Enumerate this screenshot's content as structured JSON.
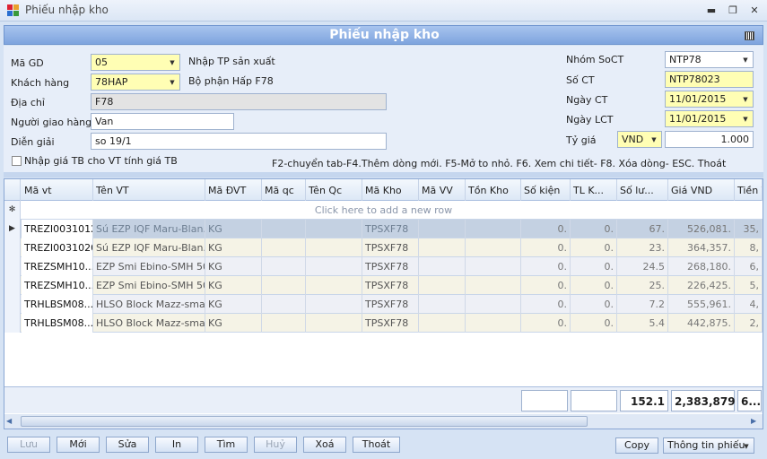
{
  "window": {
    "title": "Phiếu nhập kho",
    "minimize": "▬",
    "maximize": "❐",
    "close": "✕"
  },
  "form_title": "Phiếu nhập kho",
  "form": {
    "ma_gd": {
      "label": "Mã GD",
      "value": "05",
      "desc": "Nhập TP sản xuất"
    },
    "khach_hang": {
      "label": "Khách hàng",
      "value": "78HAP",
      "desc": "Bộ phận Hấp F78"
    },
    "dia_chi": {
      "label": "Địa chỉ",
      "value": "F78"
    },
    "nguoi_giao_hang": {
      "label": "Người giao hàng",
      "value": "Van"
    },
    "dien_giai": {
      "label": "Diễn giải",
      "value": "so 19/1"
    },
    "checkbox_label": "Nhập giá TB cho VT tính giá TB",
    "nhom_soct": {
      "label": "Nhóm SoCT",
      "value": "NTP78"
    },
    "so_ct": {
      "label": "Số CT",
      "value": "NTP78023"
    },
    "ngay_ct": {
      "label": "Ngày CT",
      "value": "11/01/2015"
    },
    "ngay_lct": {
      "label": "Ngày LCT",
      "value": "11/01/2015"
    },
    "ty_gia": {
      "label": "Tỷ giá",
      "currency": "VND",
      "rate": "1.000"
    },
    "hint": "F2-chuyển tab-F4.Thêm dòng mới. F5-Mở to nhỏ. F6. Xem chi tiết- F8. Xóa dòng- ESC. Thoát"
  },
  "grid": {
    "columns": [
      "Mã vt",
      "Tên VT",
      "Mã ĐVT",
      "Mã qc",
      "Tên Qc",
      "Mã Kho",
      "Mã VV",
      "Tồn Kho",
      "Số kiện",
      "TL K...",
      "Số lư...",
      "Giá VND",
      "Tiền V"
    ],
    "add_row_text": "Click here to add a new row",
    "new_row_marker": "✻",
    "current_row_marker": "▶",
    "rows": [
      [
        "TREZI0031012",
        "Sú EZP IQF Maru-Blan...",
        "KG",
        "",
        "",
        "TPSXF78",
        "",
        "",
        "0.",
        "0.",
        "67.",
        "526,081.",
        "35,"
      ],
      [
        "TREZI0031020",
        "Sú EZP IQF Maru-Blan...",
        "KG",
        "",
        "",
        "TPSXF78",
        "",
        "",
        "0.",
        "0.",
        "23.",
        "364,357.",
        "8,"
      ],
      [
        "TREZSMH10...",
        "EZP Smi Ebino-SMH 50...",
        "KG",
        "",
        "",
        "TPSXF78",
        "",
        "",
        "0.",
        "0.",
        "24.5",
        "268,180.",
        "6,"
      ],
      [
        "TREZSMH10...",
        "EZP Smi Ebino-SMH 50...",
        "KG",
        "",
        "",
        "TPSXF78",
        "",
        "",
        "0.",
        "0.",
        "25.",
        "226,425.",
        "5,"
      ],
      [
        "TRHLBSM08...",
        "HLSO Block Mazz-smar...",
        "KG",
        "",
        "",
        "TPSXF78",
        "",
        "",
        "0.",
        "0.",
        "7.2",
        "555,961.",
        "4,"
      ],
      [
        "TRHLBSM08...",
        "HLSO Block Mazz-smar...",
        "KG",
        "",
        "",
        "TPSXF78",
        "",
        "",
        "0.",
        "0.",
        "5.4",
        "442,875.",
        "2,"
      ]
    ],
    "totals": {
      "so_luong": "152.1",
      "gia": "2,383,879",
      "tien": "6..."
    }
  },
  "buttons": {
    "luu": "Lưu",
    "moi": "Mới",
    "sua": "Sửa",
    "in": "In",
    "tim": "Tìm",
    "huy": "Huỷ",
    "xoa": "Xoá",
    "thoat": "Thoát",
    "copy": "Copy",
    "thong_tin": "Thông tin phiếu"
  }
}
